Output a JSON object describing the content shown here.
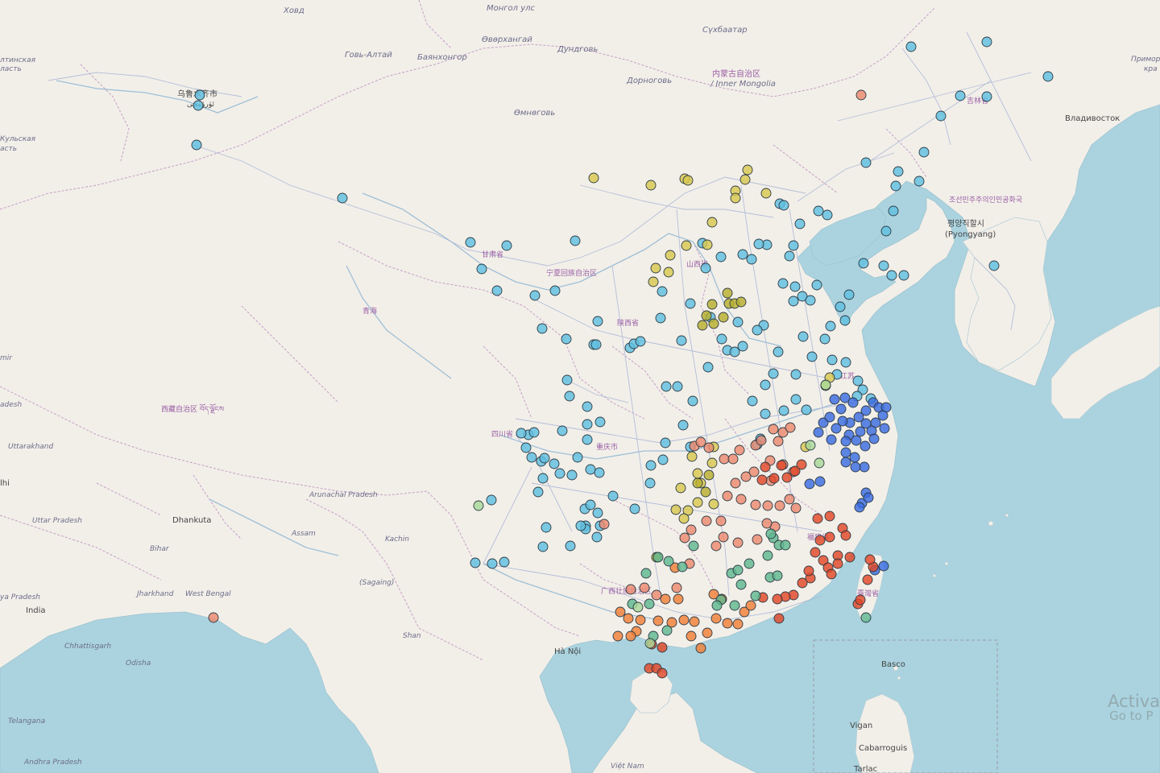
{
  "map": {
    "colors": {
      "land": "#f2efe9",
      "water": "#aad3df",
      "border": "#c9a6c9",
      "road": "#aab6d6",
      "river": "#9fbfd6"
    },
    "labels": [
      {
        "id": "khovd",
        "text": "Ховд",
        "style": "it"
      },
      {
        "id": "mongol",
        "text": "Монгол улс",
        "style": "it"
      },
      {
        "id": "sukhbaatar",
        "text": "Сүхбаатар",
        "style": "it"
      },
      {
        "id": "govi-altai",
        "text": "Говь-Алтай",
        "style": "it"
      },
      {
        "id": "bayankhongor",
        "text": "Баянхонгор",
        "style": "it"
      },
      {
        "id": "uvurkhangai",
        "text": "Өвөрхангай",
        "style": "it"
      },
      {
        "id": "dundgovi",
        "text": "Дундговь",
        "style": "it"
      },
      {
        "id": "umnugovi",
        "text": "Өмнөговь",
        "style": "it"
      },
      {
        "id": "dornogovi",
        "text": "Дорноговь",
        "style": "it"
      },
      {
        "id": "inner-mongolia-cn",
        "text": "内蒙古自治区",
        "style": "purple"
      },
      {
        "id": "inner-mongolia",
        "text": "/ Inner Mongolia",
        "style": "it"
      },
      {
        "id": "altai-1",
        "text": "лтинская",
        "style": "it"
      },
      {
        "id": "altai-2",
        "text": "ласть",
        "style": "it"
      },
      {
        "id": "kzyl-1",
        "text": "Кульская",
        "style": "it"
      },
      {
        "id": "kzyl-2",
        "text": "асть",
        "style": "it"
      },
      {
        "id": "urumqi",
        "text": "乌鲁木齐市",
        "style": "city"
      },
      {
        "id": "urumqi-ug",
        "text": "ئۈرۈمچى",
        "style": "city"
      },
      {
        "id": "vladivostok",
        "text": "Владивосток",
        "style": "city"
      },
      {
        "id": "primorsky-1",
        "text": "Примор",
        "style": "it"
      },
      {
        "id": "primorsky-2",
        "text": "кра",
        "style": "it"
      },
      {
        "id": "dprk",
        "text": "조선민주주의인민공화국",
        "style": "purple"
      },
      {
        "id": "pyongyang-ko",
        "text": "평양직할시",
        "style": "city"
      },
      {
        "id": "pyongyang",
        "text": "(Pyongyang)",
        "style": "city"
      },
      {
        "id": "jilin",
        "text": "吉林省",
        "style": "purple"
      },
      {
        "id": "gansu",
        "text": "甘肃省",
        "style": "purple"
      },
      {
        "id": "ningxia",
        "text": "宁夏回族自治区",
        "style": "purple"
      },
      {
        "id": "shanxi",
        "text": "山西省",
        "style": "purple"
      },
      {
        "id": "qinghai",
        "text": "青海",
        "style": "purple"
      },
      {
        "id": "shaanxi",
        "text": "陕西省",
        "style": "purple"
      },
      {
        "id": "jiangsu",
        "text": "江苏",
        "style": "purple"
      },
      {
        "id": "xizang",
        "text": "西藏自治区 བོད་ལྗོངས",
        "style": "purple"
      },
      {
        "id": "sichuan",
        "text": "四川省",
        "style": "purple"
      },
      {
        "id": "chongqing",
        "text": "重庆市",
        "style": "purple"
      },
      {
        "id": "fujian",
        "text": "福建省",
        "style": "purple"
      },
      {
        "id": "guangxi",
        "text": "广西壮族自治区",
        "style": "purple"
      },
      {
        "id": "taiwan",
        "text": "臺灣省",
        "style": "purple"
      },
      {
        "id": "uttarakhand",
        "text": "Uttarakhand",
        "style": "it"
      },
      {
        "id": "delhi",
        "text": "lhi",
        "style": "city"
      },
      {
        "id": "uttar-pradesh",
        "text": "Uttar Pradesh",
        "style": "it"
      },
      {
        "id": "dhankuta",
        "text": "Dhankuta",
        "style": "city"
      },
      {
        "id": "arunachal",
        "text": "Arunachal Pradesh",
        "style": "it"
      },
      {
        "id": "assam",
        "text": "Assam",
        "style": "it"
      },
      {
        "id": "bihar",
        "text": "Bihar",
        "style": "it"
      },
      {
        "id": "kachin",
        "text": "Kachin",
        "style": "it"
      },
      {
        "id": "jharkhand",
        "text": "Jharkhand",
        "style": "it"
      },
      {
        "id": "west-bengal",
        "text": "West Bengal",
        "style": "it"
      },
      {
        "id": "ya-pradesh",
        "text": "ya Pradesh",
        "style": "it"
      },
      {
        "id": "india",
        "text": "India",
        "style": "city"
      },
      {
        "id": "sagaing",
        "text": "(Sagaing)",
        "style": "it"
      },
      {
        "id": "chhattisgarh",
        "text": "Chhattisgarh",
        "style": "it"
      },
      {
        "id": "odisha",
        "text": "Odisha",
        "style": "it"
      },
      {
        "id": "shan",
        "text": "Shan",
        "style": "it"
      },
      {
        "id": "hanoi",
        "text": "Hà Nội",
        "style": "city"
      },
      {
        "id": "telangana",
        "text": "Telangana",
        "style": "it"
      },
      {
        "id": "andhra",
        "text": "Andhra Pradesh",
        "style": "it"
      },
      {
        "id": "vietnam",
        "text": "Việt Nam",
        "style": "it"
      },
      {
        "id": "basco",
        "text": "Basco",
        "style": "city"
      },
      {
        "id": "vigan",
        "text": "Vigan",
        "style": "city"
      },
      {
        "id": "cabarroguis",
        "text": "Cabarroguis",
        "style": "city"
      },
      {
        "id": "tarlac",
        "text": "Tarlac",
        "style": "city"
      },
      {
        "id": "mir",
        "text": "mir",
        "style": "it"
      },
      {
        "id": "adesh",
        "text": "adesh",
        "style": "it"
      }
    ],
    "watermark": {
      "line1": "Activa",
      "line2": "Go to P"
    },
    "point_colors": {
      "cyan": "#5fc0e0",
      "blue": "#3a6de0",
      "yellow": "#d8c850",
      "olive": "#b8b030",
      "salmon": "#ec8a70",
      "red": "#e04828",
      "orange": "#f08038",
      "green": "#5fb890",
      "lightgreen": "#a8d898"
    }
  }
}
